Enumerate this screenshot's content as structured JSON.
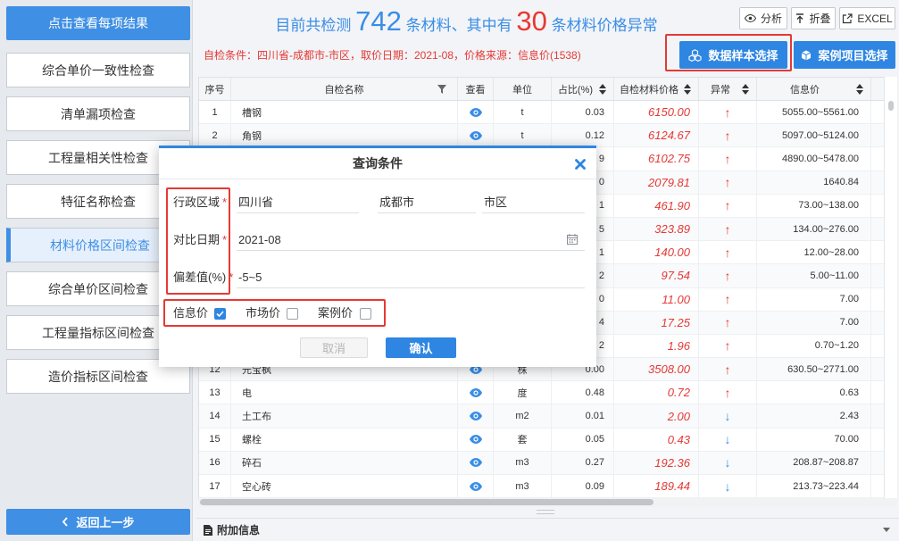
{
  "sidebar": {
    "top_button": "点击查看每项结果",
    "items": [
      {
        "label": "综合单价一致性检查",
        "active": false
      },
      {
        "label": "清单漏项检查",
        "active": false
      },
      {
        "label": "工程量相关性检查",
        "active": false
      },
      {
        "label": "特征名称检查",
        "active": false
      },
      {
        "label": "材料价格区间检查",
        "active": true
      },
      {
        "label": "综合单价区间检查",
        "active": false
      },
      {
        "label": "工程量指标区间检查",
        "active": false
      },
      {
        "label": "造价指标区间检查",
        "active": false
      }
    ],
    "back_button": "返回上一步"
  },
  "summary": {
    "prefix": "目前共检测",
    "total": "742",
    "middle": "条材料、其中有",
    "abnormal": "30",
    "suffix": "条材料价格异常"
  },
  "toolbar": {
    "analyze": "分析",
    "fold": "折叠",
    "excel": "EXCEL"
  },
  "condition": "自检条件：四川省-成都市-市区，取价日期：2021-08，价格来源：信息价(1538)",
  "actions": {
    "sample_select": "数据样本选择",
    "case_select": "案例项目选择"
  },
  "table": {
    "columns": {
      "no": "序号",
      "name": "自检名称",
      "view": "查看",
      "unit": "单位",
      "ratio": "占比(%)",
      "price": "自检材料价格",
      "flag": "异常",
      "info": "信息价"
    },
    "rows": [
      {
        "no": "1",
        "name": "槽钢",
        "unit": "t",
        "ratio": "0.03",
        "price": "6150.00",
        "flag": "↑",
        "info": "5055.00~5561.00"
      },
      {
        "no": "2",
        "name": "角钢",
        "unit": "t",
        "ratio": "0.12",
        "price": "6124.67",
        "flag": "↑",
        "info": "5097.00~5124.00"
      },
      {
        "no": "",
        "name": "",
        "unit": "",
        "ratio": "9",
        "price": "6102.75",
        "flag": "↑",
        "info": "4890.00~5478.00"
      },
      {
        "no": "",
        "name": "",
        "unit": "",
        "ratio": "0",
        "price": "2079.81",
        "flag": "↑",
        "info": "1640.84"
      },
      {
        "no": "",
        "name": "",
        "unit": "",
        "ratio": "1",
        "price": "461.90",
        "flag": "↑",
        "info": "73.00~138.00"
      },
      {
        "no": "",
        "name": "",
        "unit": "",
        "ratio": "5",
        "price": "323.89",
        "flag": "↑",
        "info": "134.00~276.00"
      },
      {
        "no": "",
        "name": "",
        "unit": "",
        "ratio": "1",
        "price": "140.00",
        "flag": "↑",
        "info": "12.00~28.00"
      },
      {
        "no": "",
        "name": "",
        "unit": "",
        "ratio": "2",
        "price": "97.54",
        "flag": "↑",
        "info": "5.00~11.00"
      },
      {
        "no": "",
        "name": "",
        "unit": "",
        "ratio": "0",
        "price": "11.00",
        "flag": "↑",
        "info": "7.00"
      },
      {
        "no": "",
        "name": "",
        "unit": "",
        "ratio": "4",
        "price": "17.25",
        "flag": "↑",
        "info": "7.00"
      },
      {
        "no": "",
        "name": "",
        "unit": "",
        "ratio": "2",
        "price": "1.96",
        "flag": "↑",
        "info": "0.70~1.20"
      },
      {
        "no": "12",
        "name": "元宝枫",
        "unit": "株",
        "ratio": "0.00",
        "price": "3508.00",
        "flag": "↑",
        "info": "630.50~2771.00"
      },
      {
        "no": "13",
        "name": "电",
        "unit": "度",
        "ratio": "0.48",
        "price": "0.72",
        "flag": "↑",
        "info": "0.63"
      },
      {
        "no": "14",
        "name": "土工布",
        "unit": "m2",
        "ratio": "0.01",
        "price": "2.00",
        "flag": "↓",
        "info": "2.43"
      },
      {
        "no": "15",
        "name": "螺栓",
        "unit": "套",
        "ratio": "0.05",
        "price": "0.43",
        "flag": "↓",
        "info": "70.00"
      },
      {
        "no": "16",
        "name": "碎石",
        "unit": "m3",
        "ratio": "0.27",
        "price": "192.36",
        "flag": "↓",
        "info": "208.87~208.87"
      },
      {
        "no": "17",
        "name": "空心砖",
        "unit": "m3",
        "ratio": "0.09",
        "price": "189.44",
        "flag": "↓",
        "info": "213.73~223.44"
      }
    ]
  },
  "footer": {
    "extra_info": "附加信息"
  },
  "dialog": {
    "title": "查询条件",
    "required_mark": "*",
    "region_label": "行政区域",
    "province": "四川省",
    "city": "成都市",
    "district": "市区",
    "date_label": "对比日期",
    "date": "2021-08",
    "deviation_label": "偏差值(%)",
    "deviation": "-5~5",
    "price_sources": [
      {
        "label": "信息价",
        "checked": true
      },
      {
        "label": "市场价",
        "checked": false
      },
      {
        "label": "案例价",
        "checked": false
      }
    ],
    "cancel": "取消",
    "confirm": "确认"
  },
  "colors": {
    "accent": "#2f86e2",
    "alert": "#e53935"
  }
}
